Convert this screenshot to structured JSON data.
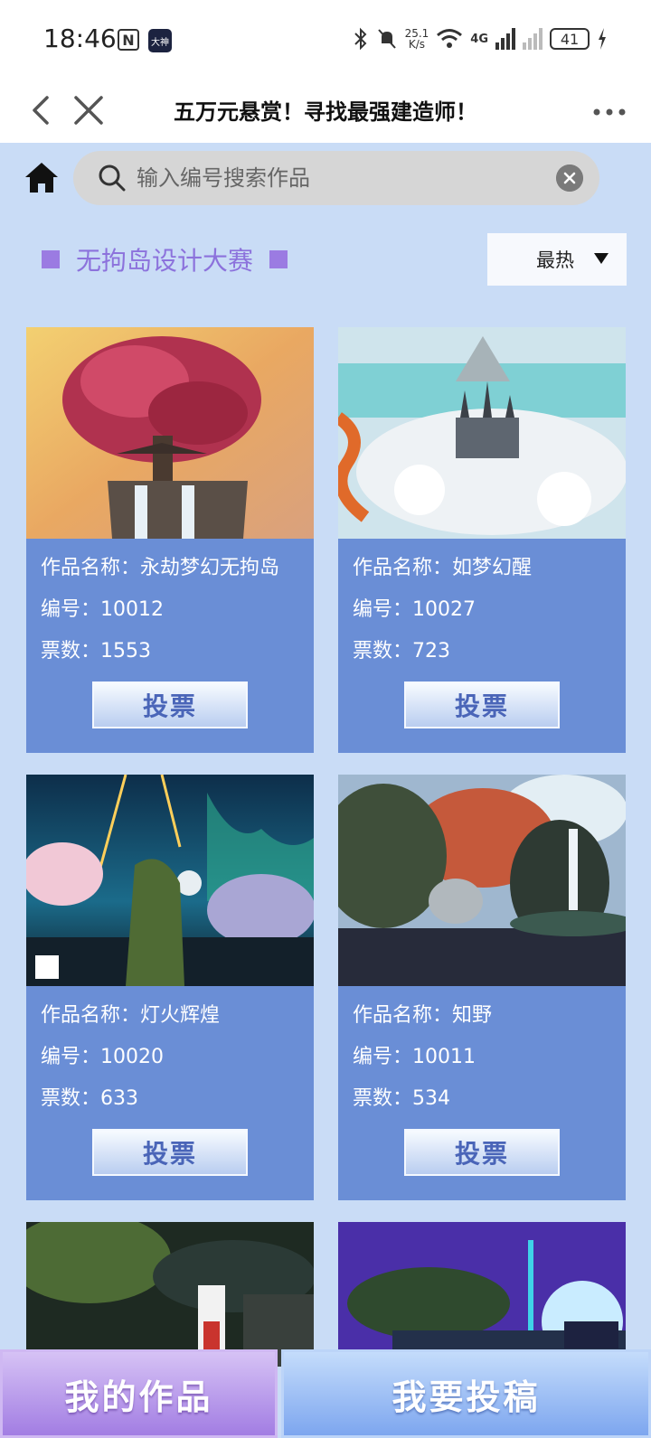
{
  "status_bar": {
    "time": "18:46",
    "nfc_label": "N",
    "app_badge": "大神",
    "speed_top": "25.1",
    "speed_bottom": "K/s",
    "network": "4G",
    "battery": "41"
  },
  "nav": {
    "title": "五万元悬赏！寻找最强建造师！"
  },
  "search": {
    "placeholder": "输入编号搜索作品"
  },
  "contest": {
    "title": "无拘岛设计大赛",
    "sort_value": "最热"
  },
  "labels": {
    "name": "作品名称：",
    "id": "编号：",
    "votes": "票数：",
    "vote_button": "投票"
  },
  "works": [
    {
      "name": "永劫梦幻无拘岛",
      "id": "10012",
      "votes": "1553"
    },
    {
      "name": "如梦幻醒",
      "id": "10027",
      "votes": "723"
    },
    {
      "name": "灯火辉煌",
      "id": "10020",
      "votes": "633"
    },
    {
      "name": "知野",
      "id": "10011",
      "votes": "534"
    }
  ],
  "bottom": {
    "my_works": "我的作品",
    "submit": "我要投稿"
  }
}
